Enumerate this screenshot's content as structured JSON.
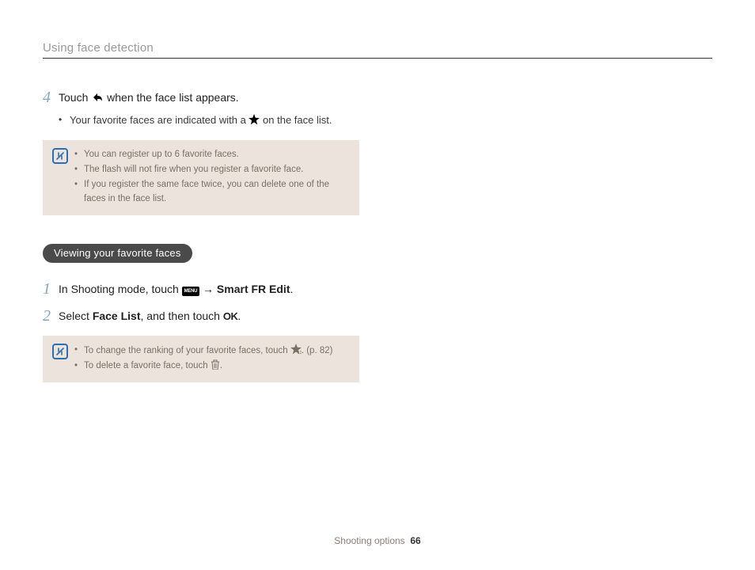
{
  "header": {
    "title": "Using face detection"
  },
  "step4": {
    "num": "4",
    "text_before": "Touch ",
    "text_after": " when the face list appears.",
    "bullet_before": "Your favorite faces are indicated with a ",
    "bullet_after": " on the face list."
  },
  "note1": {
    "items": [
      "You can register up to 6 favorite faces.",
      "The flash will not fire when you register a favorite face.",
      "If you register the same face twice, you can delete one of the faces in the face list."
    ]
  },
  "section": {
    "title": "Viewing your favorite faces"
  },
  "step1": {
    "num": "1",
    "text_before": "In Shooting mode, touch ",
    "arrow": " → ",
    "bold": "Smart FR Edit",
    "period": "."
  },
  "step2": {
    "num": "2",
    "text_a": "Select ",
    "bold": "Face List",
    "text_b": ", and then touch ",
    "period": "."
  },
  "note2": {
    "item1_before": "To change the ranking of your favorite faces, touch ",
    "item1_after": ". (p. 82)",
    "item2_before": "To delete a favorite face, touch ",
    "item2_after": "."
  },
  "footer": {
    "section": "Shooting options",
    "page": "66"
  },
  "icons": {
    "menu_label": "MENU",
    "ok_label": "OK"
  }
}
